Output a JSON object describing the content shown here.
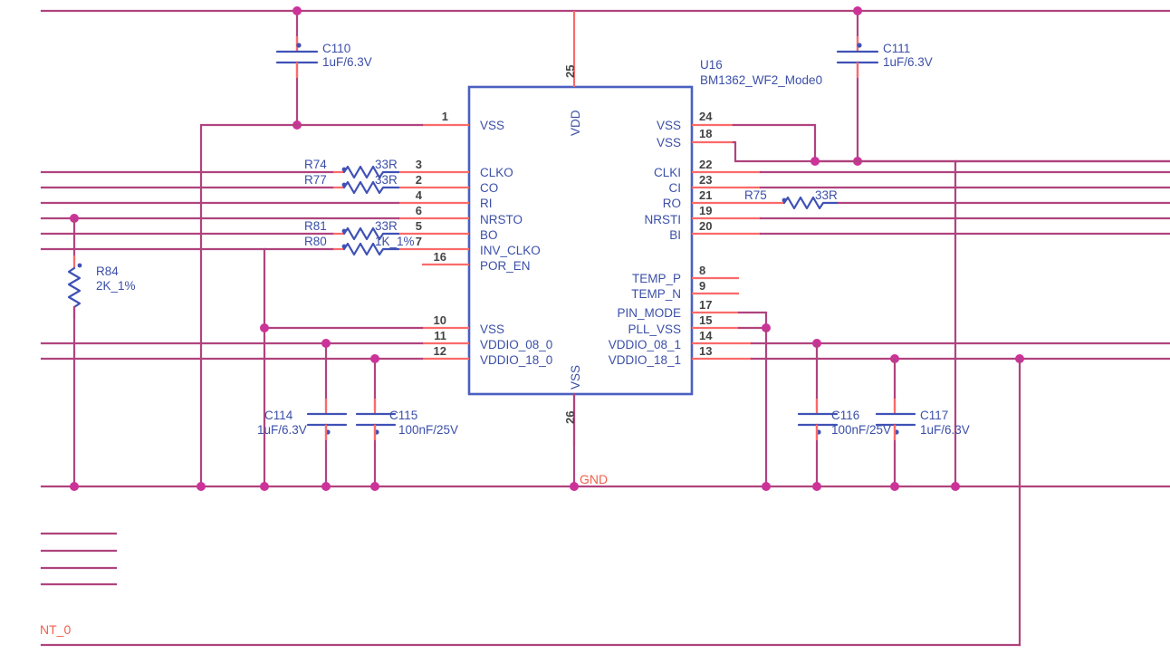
{
  "sheet": {
    "title": "BM1362_WF2_Mode0 schematic fragment",
    "background": "#ffffff",
    "wire_color": "#b0437e",
    "pin_color": "#fb6a6a",
    "junction_color": "#cc3399",
    "symbol_color": "#3f51b5",
    "net_label_color": "#f0604d"
  },
  "ic": {
    "designator": "U16",
    "part": "BM1362_WF2_Mode0",
    "left_pins": [
      {
        "num": "1",
        "name": "VSS"
      },
      {
        "num": "3",
        "name": "CLKO"
      },
      {
        "num": "2",
        "name": "CO"
      },
      {
        "num": "4",
        "name": "RI"
      },
      {
        "num": "6",
        "name": "NRSTO"
      },
      {
        "num": "5",
        "name": "BO"
      },
      {
        "num": "7",
        "name": "INV_CLKO"
      },
      {
        "num": "16",
        "name": "POR_EN"
      },
      {
        "num": "10",
        "name": "VSS"
      },
      {
        "num": "11",
        "name": "VDDIO_08_0"
      },
      {
        "num": "12",
        "name": "VDDIO_18_0"
      }
    ],
    "right_pins": [
      {
        "num": "24",
        "name": "VSS"
      },
      {
        "num": "18",
        "name": "VSS"
      },
      {
        "num": "22",
        "name": "CLKI"
      },
      {
        "num": "23",
        "name": "CI"
      },
      {
        "num": "21",
        "name": "RO"
      },
      {
        "num": "19",
        "name": "NRSTI"
      },
      {
        "num": "20",
        "name": "BI"
      },
      {
        "num": "8",
        "name": "TEMP_P"
      },
      {
        "num": "9",
        "name": "TEMP_N"
      },
      {
        "num": "17",
        "name": "PIN_MODE"
      },
      {
        "num": "15",
        "name": "PLL_VSS"
      },
      {
        "num": "14",
        "name": "VDDIO_08_1"
      },
      {
        "num": "13",
        "name": "VDDIO_18_1"
      }
    ],
    "top_pin": {
      "num": "25",
      "name": "VDD"
    },
    "bottom_pin": {
      "num": "26",
      "name": "VSS"
    }
  },
  "components": {
    "capacitors": [
      {
        "ref": "C110",
        "value": "1uF/6.3V"
      },
      {
        "ref": "C111",
        "value": "1uF/6.3V"
      },
      {
        "ref": "C114",
        "value": "1uF/6.3V"
      },
      {
        "ref": "C115",
        "value": "100nF/25V"
      },
      {
        "ref": "C116",
        "value": "100nF/25V"
      },
      {
        "ref": "C117",
        "value": "1uF/6.3V"
      }
    ],
    "resistors": [
      {
        "ref": "R74",
        "value": "33R"
      },
      {
        "ref": "R77",
        "value": "33R"
      },
      {
        "ref": "R81",
        "value": "33R"
      },
      {
        "ref": "R80",
        "value": "1K_1%"
      },
      {
        "ref": "R75",
        "value": "33R"
      },
      {
        "ref": "R84",
        "value": "2K_1%"
      }
    ]
  },
  "net_labels": [
    {
      "text": "GND"
    },
    {
      "text": "NT_0"
    }
  ]
}
